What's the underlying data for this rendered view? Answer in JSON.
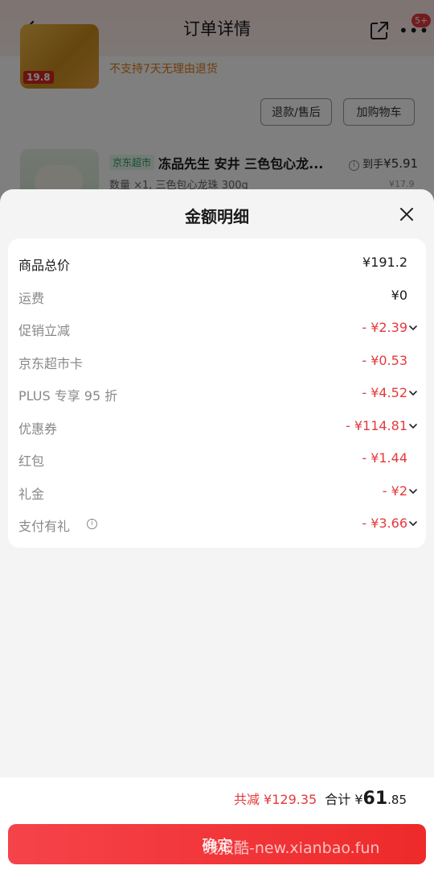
{
  "nav": {
    "title": "订单详情",
    "badge": "5+"
  },
  "background_items": [
    {
      "price_tag": "19.8",
      "note": "不支持7天无理由退货",
      "buttons": [
        "退款/售后",
        "加购物车"
      ]
    },
    {
      "store_tag": "京东超市",
      "title": "冻品先生 安井 三色包心龙...",
      "price_prefix": "到手",
      "price": "¥5.91",
      "original_price": "¥17.9",
      "sub": "数量 ×1, 三色包心龙珠 300g"
    }
  ],
  "sheet": {
    "title": "金额明细",
    "rows": [
      {
        "label": "商品总价",
        "value": "¥191.2",
        "emphasis": true,
        "red": false,
        "chevron": false
      },
      {
        "label": "运费",
        "value": "¥0",
        "emphasis": false,
        "red": false,
        "chevron": false
      },
      {
        "label": "促销立减",
        "value": "- ¥2.39",
        "emphasis": false,
        "red": true,
        "chevron": true
      },
      {
        "label": "京东超市卡",
        "value": "- ¥0.53",
        "emphasis": false,
        "red": true,
        "chevron": false
      },
      {
        "label": "PLUS 专享 95 折",
        "value": "- ¥4.52",
        "emphasis": false,
        "red": true,
        "chevron": true
      },
      {
        "label": "优惠券",
        "value": "- ¥114.81",
        "emphasis": false,
        "red": true,
        "chevron": true
      },
      {
        "label": "红包",
        "value": "- ¥1.44",
        "emphasis": false,
        "red": true,
        "chevron": false
      },
      {
        "label": "礼金",
        "value": "- ¥2",
        "emphasis": false,
        "red": true,
        "chevron": true
      },
      {
        "label": "支付有礼",
        "value": "- ¥3.66",
        "emphasis": false,
        "red": true,
        "chevron": true,
        "info": true
      }
    ]
  },
  "footer": {
    "reduce": "共减 ¥129.35",
    "total_label": "合计",
    "total_currency": "¥",
    "total_int": "61",
    "total_dec": ".85",
    "confirm_label": "确定",
    "watermark": "线报酷-new.xianbao.fun"
  },
  "colors": {
    "accent": "#e4393c",
    "confirm": "#f03a3a"
  }
}
